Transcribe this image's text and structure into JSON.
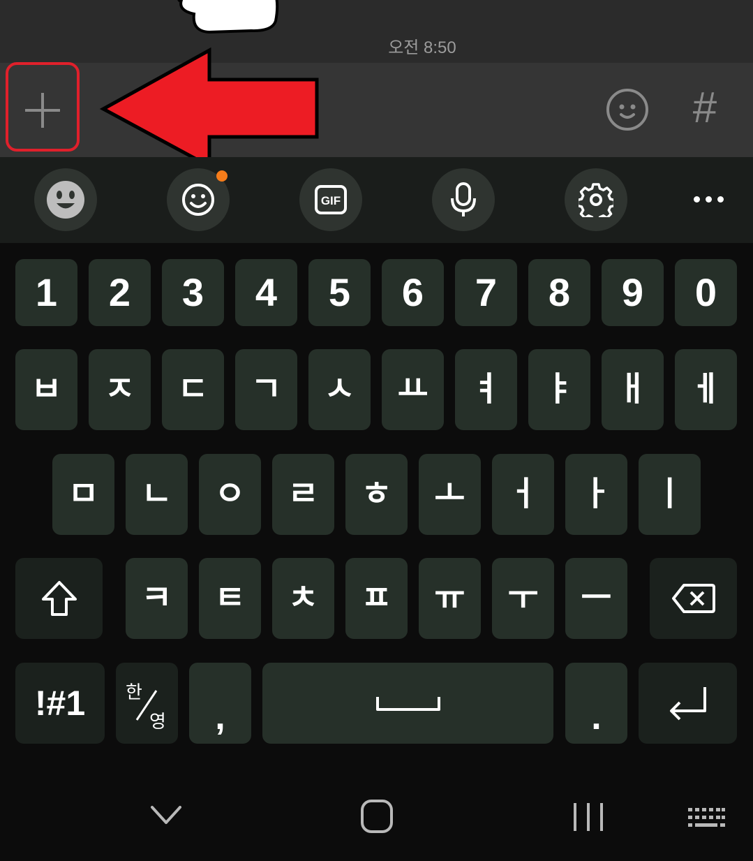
{
  "chat": {
    "timestamp": "오전 8:50"
  },
  "input_bar": {
    "plus_icon": "plus-icon",
    "emoticon_icon": "emoticon-face-icon",
    "hash_label": "#",
    "annotation_color": "#e0202b"
  },
  "keyboard_toolbar": {
    "items": [
      "face-emoji-icon",
      "emoji-icon",
      "gif-icon",
      "microphone-icon",
      "settings-gear-icon",
      "more-dots-icon"
    ],
    "gif_label": "GIF",
    "notification_dot_color": "#f57c1a"
  },
  "keys": {
    "numbers": [
      "1",
      "2",
      "3",
      "4",
      "5",
      "6",
      "7",
      "8",
      "9",
      "0"
    ],
    "row1": [
      "ㅂ",
      "ㅈ",
      "ㄷ",
      "ㄱ",
      "ㅅ",
      "ㅛ",
      "ㅕ",
      "ㅑ",
      "ㅐ",
      "ㅔ"
    ],
    "row2": [
      "ㅁ",
      "ㄴ",
      "ㅇ",
      "ㄹ",
      "ㅎ",
      "ㅗ",
      "ㅓ",
      "ㅏ",
      "ㅣ"
    ],
    "row3": [
      "ㅋ",
      "ㅌ",
      "ㅊ",
      "ㅍ",
      "ㅠ",
      "ㅜ",
      "ㅡ"
    ],
    "symbols": "!#1",
    "lang_top": "한",
    "lang_bottom": "영",
    "comma": ",",
    "period": "."
  },
  "navbar": [
    "collapse-chevron-icon",
    "home-icon",
    "recents-icon",
    "keyboard-switch-icon"
  ]
}
